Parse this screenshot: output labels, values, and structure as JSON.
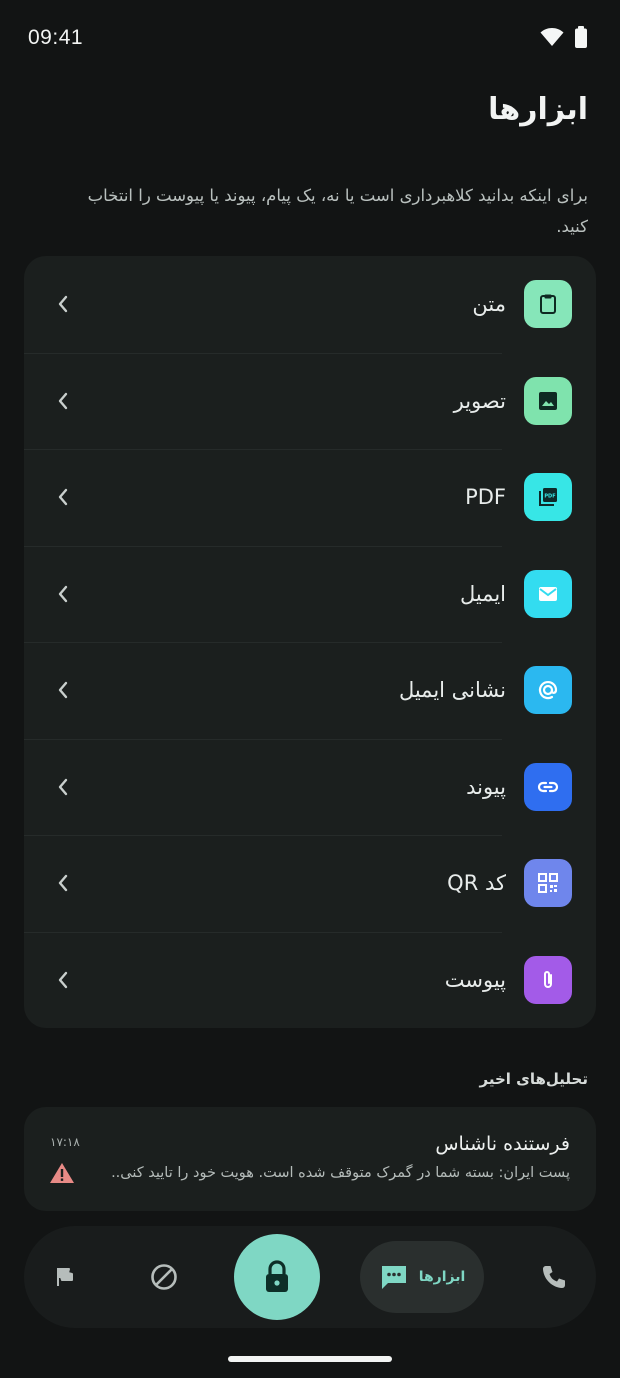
{
  "status_bar": {
    "time": "09:41"
  },
  "page": {
    "title": "ابزارها",
    "subtitle": "برای اینکه بدانید کلاهبرداری است یا نه، یک پیام، پیوند یا پیوست را انتخاب کنید."
  },
  "tools": [
    {
      "label": "متن",
      "icon": "clipboard-icon",
      "color": "#86e6b9"
    },
    {
      "label": "تصویر",
      "icon": "image-icon",
      "color": "#7fe3ad"
    },
    {
      "label": "PDF",
      "icon": "pdf-icon",
      "color": "#37e6e6"
    },
    {
      "label": "ایمیل",
      "icon": "mail-icon",
      "color": "#33dcf0"
    },
    {
      "label": "نشانی ایمیل",
      "icon": "at-sign-icon",
      "color": "#2bb8f0"
    },
    {
      "label": "پیوند",
      "icon": "link-icon",
      "color": "#2f6ef0"
    },
    {
      "label": "کد QR",
      "icon": "qr-code-icon",
      "color": "#6f86ec"
    },
    {
      "label": "پیوست",
      "icon": "paperclip-icon",
      "color": "#a35be8"
    }
  ],
  "recent": {
    "section_title": "تحلیل‌های اخیر",
    "items": [
      {
        "sender": "فرستنده ناشناس",
        "time": "۱۷:۱۸",
        "preview": "پست ایران: بسته شما در گمرک متوقف شده است. هویت خود را تایید کنی..",
        "warning_color": "#e88a86"
      }
    ]
  },
  "nav": {
    "tools_label": "ابزارها",
    "accent": "#7fd7c4"
  }
}
